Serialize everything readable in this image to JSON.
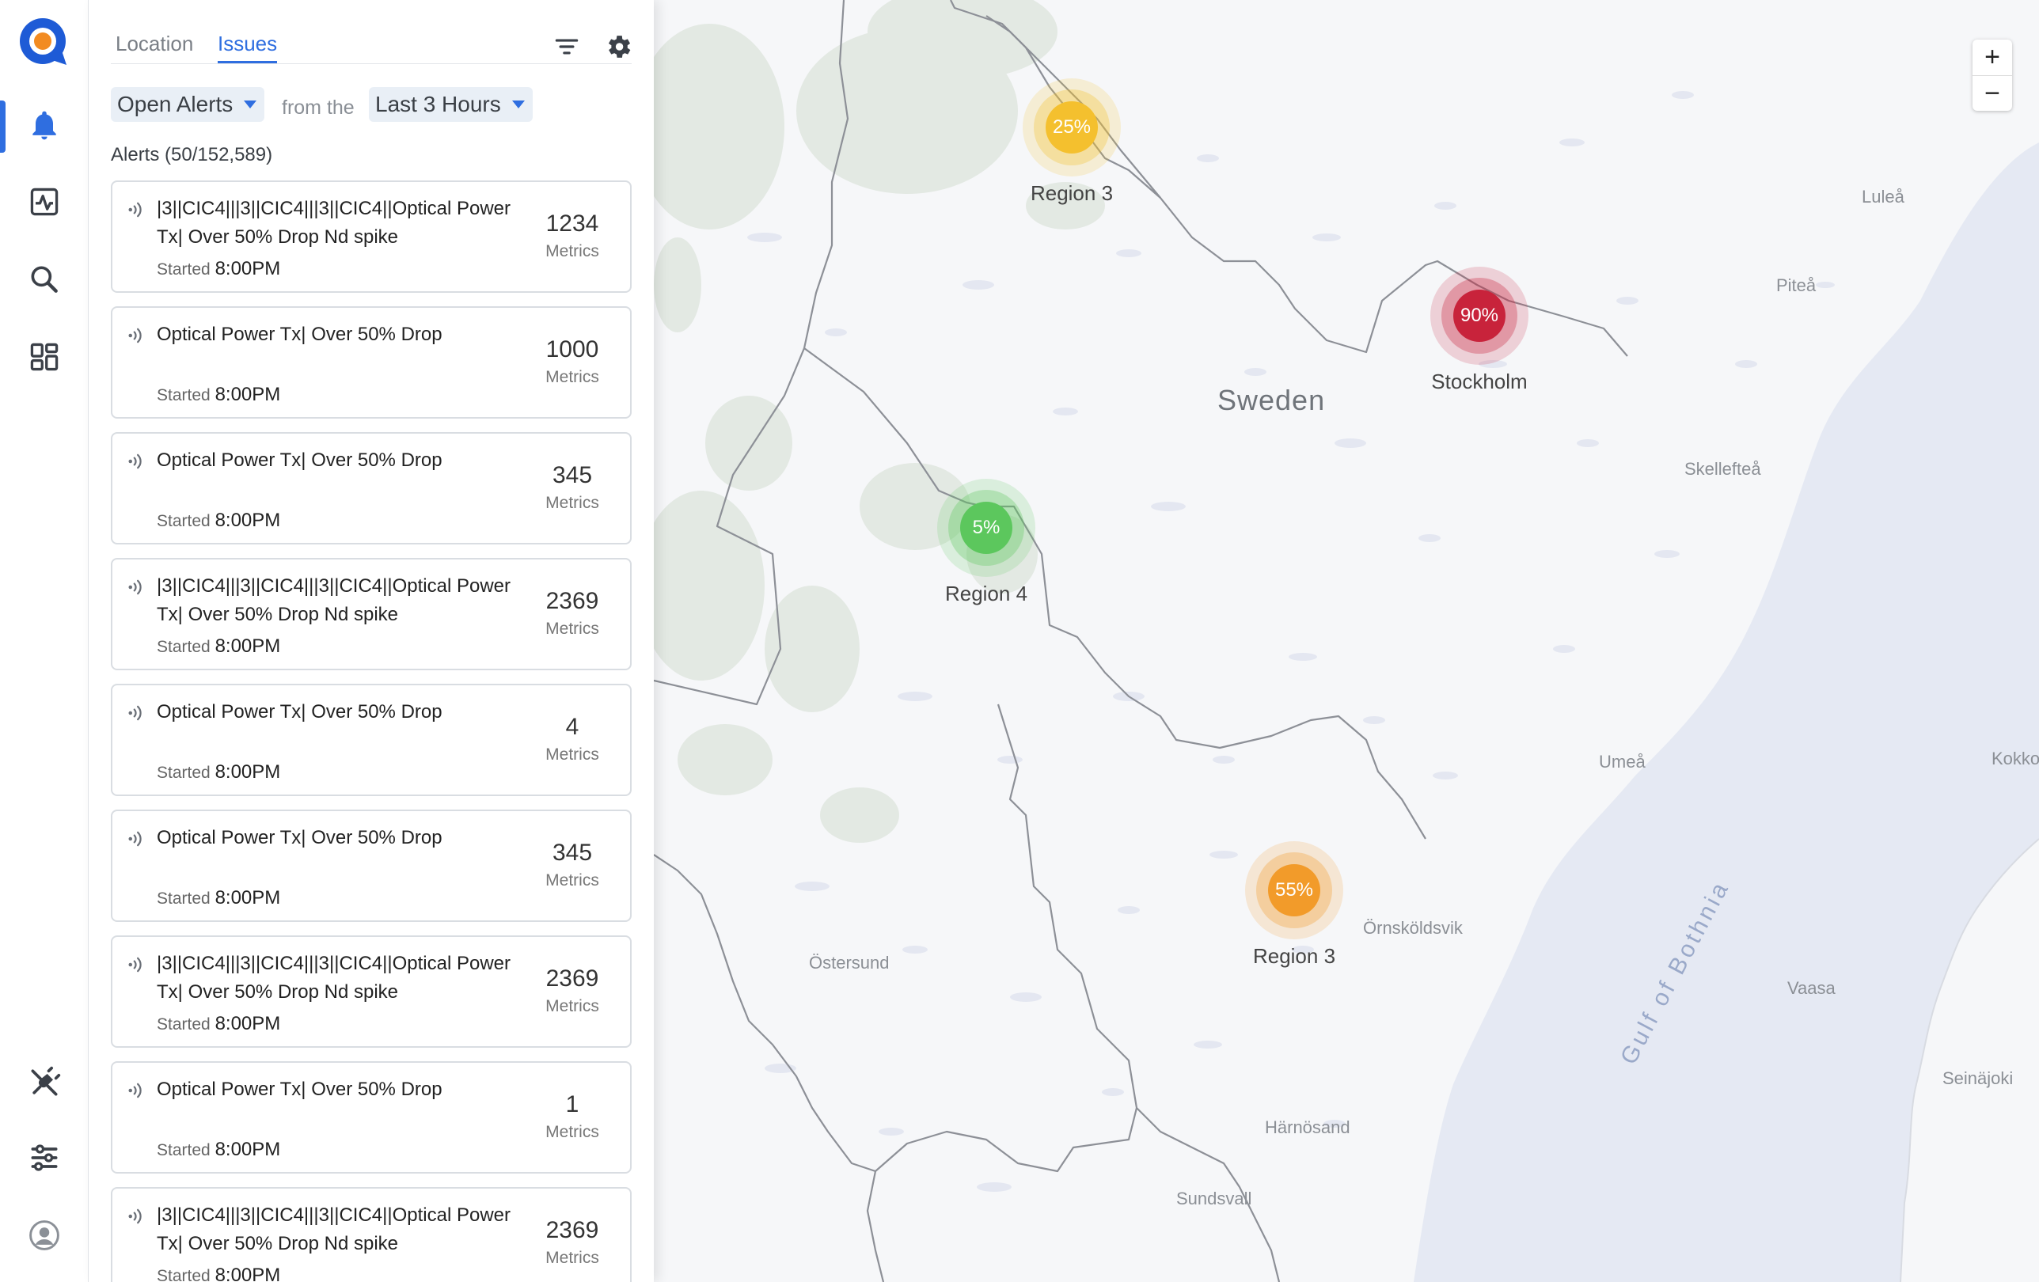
{
  "nav": {
    "logo": "app-logo",
    "top_items": [
      "bell-icon",
      "chart-icon",
      "search-icon",
      "dashboard-icon"
    ],
    "bottom_items": [
      "plug-icon",
      "sliders-icon",
      "user-icon"
    ],
    "active": "bell-icon",
    "accent": "#2f6ee0"
  },
  "panel": {
    "tabs": [
      {
        "label": "Location",
        "active": false
      },
      {
        "label": "Issues",
        "active": true
      }
    ],
    "icons": [
      "filter-icon",
      "gear-icon"
    ],
    "filter": {
      "status": "Open Alerts",
      "connector": "from the",
      "range": "Last 3 Hours"
    },
    "alerts_count": "Alerts (50/152,589)",
    "alerts": [
      {
        "title": "|3||CIC4|||3||CIC4|||3||CIC4||Optical Power Tx|  Over 50% Drop Nd spike",
        "started_label": "Started",
        "time": "8:00PM",
        "metric": "1234",
        "metric_unit": "Metrics"
      },
      {
        "title": "Optical Power Tx| Over 50% Drop",
        "started_label": "Started",
        "time": "8:00PM",
        "metric": "1000",
        "metric_unit": "Metrics"
      },
      {
        "title": "Optical Power Tx| Over 50% Drop",
        "started_label": "Started",
        "time": "8:00PM",
        "metric": "345",
        "metric_unit": "Metrics"
      },
      {
        "title": "|3||CIC4|||3||CIC4|||3||CIC4||Optical Power Tx|  Over 50% Drop Nd spike",
        "started_label": "Started",
        "time": "8:00PM",
        "metric": "2369",
        "metric_unit": "Metrics"
      },
      {
        "title": "Optical Power Tx| Over 50% Drop",
        "started_label": "Started",
        "time": "8:00PM",
        "metric": "4",
        "metric_unit": "Metrics"
      },
      {
        "title": "Optical Power Tx| Over 50% Drop",
        "started_label": "Started",
        "time": "8:00PM",
        "metric": "345",
        "metric_unit": "Metrics"
      },
      {
        "title": "|3||CIC4|||3||CIC4|||3||CIC4||Optical Power Tx|  Over 50% Drop Nd spike",
        "started_label": "Started",
        "time": "8:00PM",
        "metric": "2369",
        "metric_unit": "Metrics"
      },
      {
        "title": "Optical Power Tx| Over 50% Drop",
        "started_label": "Started",
        "time": "8:00PM",
        "metric": "1",
        "metric_unit": "Metrics"
      },
      {
        "title": "|3||CIC4|||3||CIC4|||3||CIC4||Optical Power Tx|  Over 50% Drop Nd spike",
        "started_label": "Started",
        "time": "8:00PM",
        "metric": "2369",
        "metric_unit": "Metrics"
      }
    ]
  },
  "map": {
    "country": "Sweden",
    "sea": "Gulf of Bothnia",
    "places": [
      "Luleå",
      "Piteå",
      "Skellefteå",
      "Umeå",
      "Örnsköldsvik",
      "Östersund",
      "Härnösand",
      "Sundsvall",
      "Vaasa",
      "Seinäjoki",
      "Kokkol"
    ],
    "markers": [
      {
        "label": "Region 3",
        "value": "25%",
        "color": "#f4c02e"
      },
      {
        "label": "Stockholm",
        "value": "90%",
        "color": "#c8233b"
      },
      {
        "label": "Region 4",
        "value": "5%",
        "color": "#5cc75d"
      },
      {
        "label": "Region 3",
        "value": "55%",
        "color": "#f29b2a"
      }
    ],
    "zoom": {
      "in": "+",
      "out": "−"
    }
  }
}
